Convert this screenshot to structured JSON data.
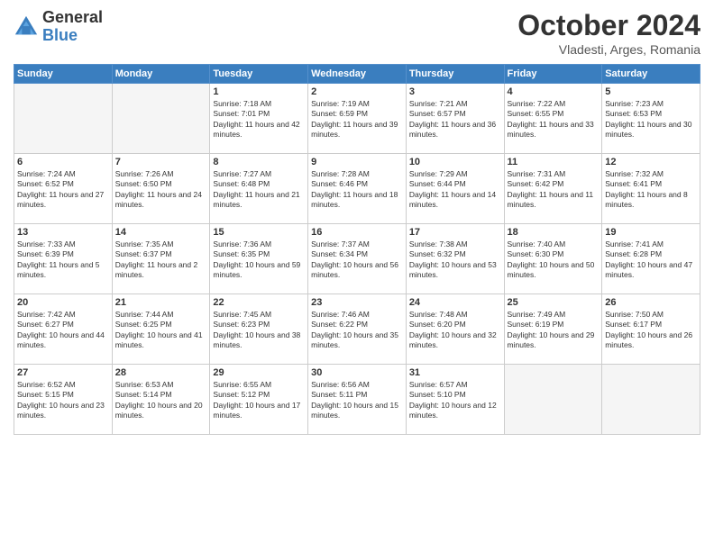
{
  "header": {
    "logo_general": "General",
    "logo_blue": "Blue",
    "month_title": "October 2024",
    "location": "Vladesti, Arges, Romania"
  },
  "weekdays": [
    "Sunday",
    "Monday",
    "Tuesday",
    "Wednesday",
    "Thursday",
    "Friday",
    "Saturday"
  ],
  "weeks": [
    [
      {
        "day": "",
        "sunrise": "",
        "sunset": "",
        "daylight": "",
        "empty": true
      },
      {
        "day": "",
        "sunrise": "",
        "sunset": "",
        "daylight": "",
        "empty": true
      },
      {
        "day": "1",
        "sunrise": "Sunrise: 7:18 AM",
        "sunset": "Sunset: 7:01 PM",
        "daylight": "Daylight: 11 hours and 42 minutes."
      },
      {
        "day": "2",
        "sunrise": "Sunrise: 7:19 AM",
        "sunset": "Sunset: 6:59 PM",
        "daylight": "Daylight: 11 hours and 39 minutes."
      },
      {
        "day": "3",
        "sunrise": "Sunrise: 7:21 AM",
        "sunset": "Sunset: 6:57 PM",
        "daylight": "Daylight: 11 hours and 36 minutes."
      },
      {
        "day": "4",
        "sunrise": "Sunrise: 7:22 AM",
        "sunset": "Sunset: 6:55 PM",
        "daylight": "Daylight: 11 hours and 33 minutes."
      },
      {
        "day": "5",
        "sunrise": "Sunrise: 7:23 AM",
        "sunset": "Sunset: 6:53 PM",
        "daylight": "Daylight: 11 hours and 30 minutes."
      }
    ],
    [
      {
        "day": "6",
        "sunrise": "Sunrise: 7:24 AM",
        "sunset": "Sunset: 6:52 PM",
        "daylight": "Daylight: 11 hours and 27 minutes."
      },
      {
        "day": "7",
        "sunrise": "Sunrise: 7:26 AM",
        "sunset": "Sunset: 6:50 PM",
        "daylight": "Daylight: 11 hours and 24 minutes."
      },
      {
        "day": "8",
        "sunrise": "Sunrise: 7:27 AM",
        "sunset": "Sunset: 6:48 PM",
        "daylight": "Daylight: 11 hours and 21 minutes."
      },
      {
        "day": "9",
        "sunrise": "Sunrise: 7:28 AM",
        "sunset": "Sunset: 6:46 PM",
        "daylight": "Daylight: 11 hours and 18 minutes."
      },
      {
        "day": "10",
        "sunrise": "Sunrise: 7:29 AM",
        "sunset": "Sunset: 6:44 PM",
        "daylight": "Daylight: 11 hours and 14 minutes."
      },
      {
        "day": "11",
        "sunrise": "Sunrise: 7:31 AM",
        "sunset": "Sunset: 6:42 PM",
        "daylight": "Daylight: 11 hours and 11 minutes."
      },
      {
        "day": "12",
        "sunrise": "Sunrise: 7:32 AM",
        "sunset": "Sunset: 6:41 PM",
        "daylight": "Daylight: 11 hours and 8 minutes."
      }
    ],
    [
      {
        "day": "13",
        "sunrise": "Sunrise: 7:33 AM",
        "sunset": "Sunset: 6:39 PM",
        "daylight": "Daylight: 11 hours and 5 minutes."
      },
      {
        "day": "14",
        "sunrise": "Sunrise: 7:35 AM",
        "sunset": "Sunset: 6:37 PM",
        "daylight": "Daylight: 11 hours and 2 minutes."
      },
      {
        "day": "15",
        "sunrise": "Sunrise: 7:36 AM",
        "sunset": "Sunset: 6:35 PM",
        "daylight": "Daylight: 10 hours and 59 minutes."
      },
      {
        "day": "16",
        "sunrise": "Sunrise: 7:37 AM",
        "sunset": "Sunset: 6:34 PM",
        "daylight": "Daylight: 10 hours and 56 minutes."
      },
      {
        "day": "17",
        "sunrise": "Sunrise: 7:38 AM",
        "sunset": "Sunset: 6:32 PM",
        "daylight": "Daylight: 10 hours and 53 minutes."
      },
      {
        "day": "18",
        "sunrise": "Sunrise: 7:40 AM",
        "sunset": "Sunset: 6:30 PM",
        "daylight": "Daylight: 10 hours and 50 minutes."
      },
      {
        "day": "19",
        "sunrise": "Sunrise: 7:41 AM",
        "sunset": "Sunset: 6:28 PM",
        "daylight": "Daylight: 10 hours and 47 minutes."
      }
    ],
    [
      {
        "day": "20",
        "sunrise": "Sunrise: 7:42 AM",
        "sunset": "Sunset: 6:27 PM",
        "daylight": "Daylight: 10 hours and 44 minutes."
      },
      {
        "day": "21",
        "sunrise": "Sunrise: 7:44 AM",
        "sunset": "Sunset: 6:25 PM",
        "daylight": "Daylight: 10 hours and 41 minutes."
      },
      {
        "day": "22",
        "sunrise": "Sunrise: 7:45 AM",
        "sunset": "Sunset: 6:23 PM",
        "daylight": "Daylight: 10 hours and 38 minutes."
      },
      {
        "day": "23",
        "sunrise": "Sunrise: 7:46 AM",
        "sunset": "Sunset: 6:22 PM",
        "daylight": "Daylight: 10 hours and 35 minutes."
      },
      {
        "day": "24",
        "sunrise": "Sunrise: 7:48 AM",
        "sunset": "Sunset: 6:20 PM",
        "daylight": "Daylight: 10 hours and 32 minutes."
      },
      {
        "day": "25",
        "sunrise": "Sunrise: 7:49 AM",
        "sunset": "Sunset: 6:19 PM",
        "daylight": "Daylight: 10 hours and 29 minutes."
      },
      {
        "day": "26",
        "sunrise": "Sunrise: 7:50 AM",
        "sunset": "Sunset: 6:17 PM",
        "daylight": "Daylight: 10 hours and 26 minutes."
      }
    ],
    [
      {
        "day": "27",
        "sunrise": "Sunrise: 6:52 AM",
        "sunset": "Sunset: 5:15 PM",
        "daylight": "Daylight: 10 hours and 23 minutes."
      },
      {
        "day": "28",
        "sunrise": "Sunrise: 6:53 AM",
        "sunset": "Sunset: 5:14 PM",
        "daylight": "Daylight: 10 hours and 20 minutes."
      },
      {
        "day": "29",
        "sunrise": "Sunrise: 6:55 AM",
        "sunset": "Sunset: 5:12 PM",
        "daylight": "Daylight: 10 hours and 17 minutes."
      },
      {
        "day": "30",
        "sunrise": "Sunrise: 6:56 AM",
        "sunset": "Sunset: 5:11 PM",
        "daylight": "Daylight: 10 hours and 15 minutes."
      },
      {
        "day": "31",
        "sunrise": "Sunrise: 6:57 AM",
        "sunset": "Sunset: 5:10 PM",
        "daylight": "Daylight: 10 hours and 12 minutes."
      },
      {
        "day": "",
        "sunrise": "",
        "sunset": "",
        "daylight": "",
        "empty": true
      },
      {
        "day": "",
        "sunrise": "",
        "sunset": "",
        "daylight": "",
        "empty": true
      }
    ]
  ]
}
